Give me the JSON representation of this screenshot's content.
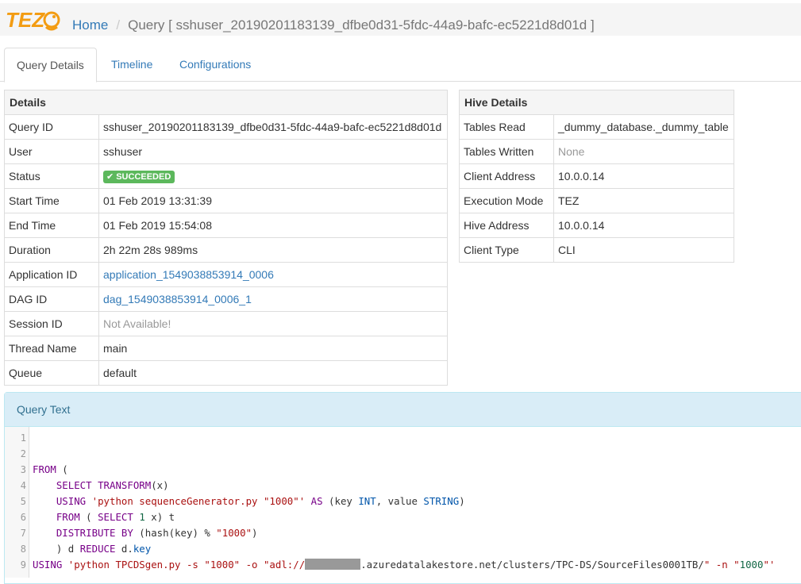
{
  "header": {
    "breadcrumb_home": "Home",
    "breadcrumb_sep": "/",
    "breadcrumb_current": "Query [ sshuser_20190201183139_dfbe0d31-5fdc-44a9-bafc-ec5221d8d01d ]",
    "logo_text": "TEZ"
  },
  "tabs": [
    {
      "label": "Query Details"
    },
    {
      "label": "Timeline"
    },
    {
      "label": "Configurations"
    }
  ],
  "details": {
    "title": "Details",
    "rows": [
      {
        "key": "Query ID",
        "value": "sshuser_20190201183139_dfbe0d31-5fdc-44a9-bafc-ec5221d8d01d"
      },
      {
        "key": "User",
        "value": "sshuser"
      },
      {
        "key": "Status",
        "value": "SUCCEEDED"
      },
      {
        "key": "Start Time",
        "value": "01 Feb 2019 13:31:39"
      },
      {
        "key": "End Time",
        "value": "01 Feb 2019 15:54:08"
      },
      {
        "key": "Duration",
        "value": "2h 22m 28s 989ms"
      },
      {
        "key": "Application ID",
        "value": "application_1549038853914_0006"
      },
      {
        "key": "DAG ID",
        "value": "dag_1549038853914_0006_1"
      },
      {
        "key": "Session ID",
        "value": "Not Available!"
      },
      {
        "key": "Thread Name",
        "value": "main"
      },
      {
        "key": "Queue",
        "value": "default"
      }
    ]
  },
  "hive": {
    "title": "Hive Details",
    "rows": [
      {
        "key": "Tables Read",
        "value": "_dummy_database._dummy_table"
      },
      {
        "key": "Tables Written",
        "value": "None"
      },
      {
        "key": "Client Address",
        "value": "10.0.0.14"
      },
      {
        "key": "Execution Mode",
        "value": "TEZ"
      },
      {
        "key": "Hive Address",
        "value": "10.0.0.14"
      },
      {
        "key": "Client Type",
        "value": "CLI"
      }
    ]
  },
  "query_text": {
    "title": "Query Text",
    "line_numbers": [
      "1",
      "2",
      "3",
      "4",
      "5",
      "6",
      "7",
      "8",
      "9"
    ],
    "lines": [
      "",
      "",
      "FROM (",
      "    SELECT TRANSFORM(x)",
      "    USING 'python sequenceGenerator.py \"1000\"' AS (key INT, value STRING)",
      "    FROM ( SELECT 1 x) t",
      "    DISTRIBUTE BY (hash(key) % \"1000\")",
      "    ) d REDUCE d.key",
      "USING 'python TPCDSgen.py -s \"1000\" -o \"adl://",
      ".azuredatalakestore.net/clusters/TPC-DS/SourceFiles0001TB/\" -n \"1000\"'"
    ]
  },
  "colors": {
    "link": "#337ab7",
    "success": "#5cb85c",
    "panel_head": "#d9edf7"
  }
}
